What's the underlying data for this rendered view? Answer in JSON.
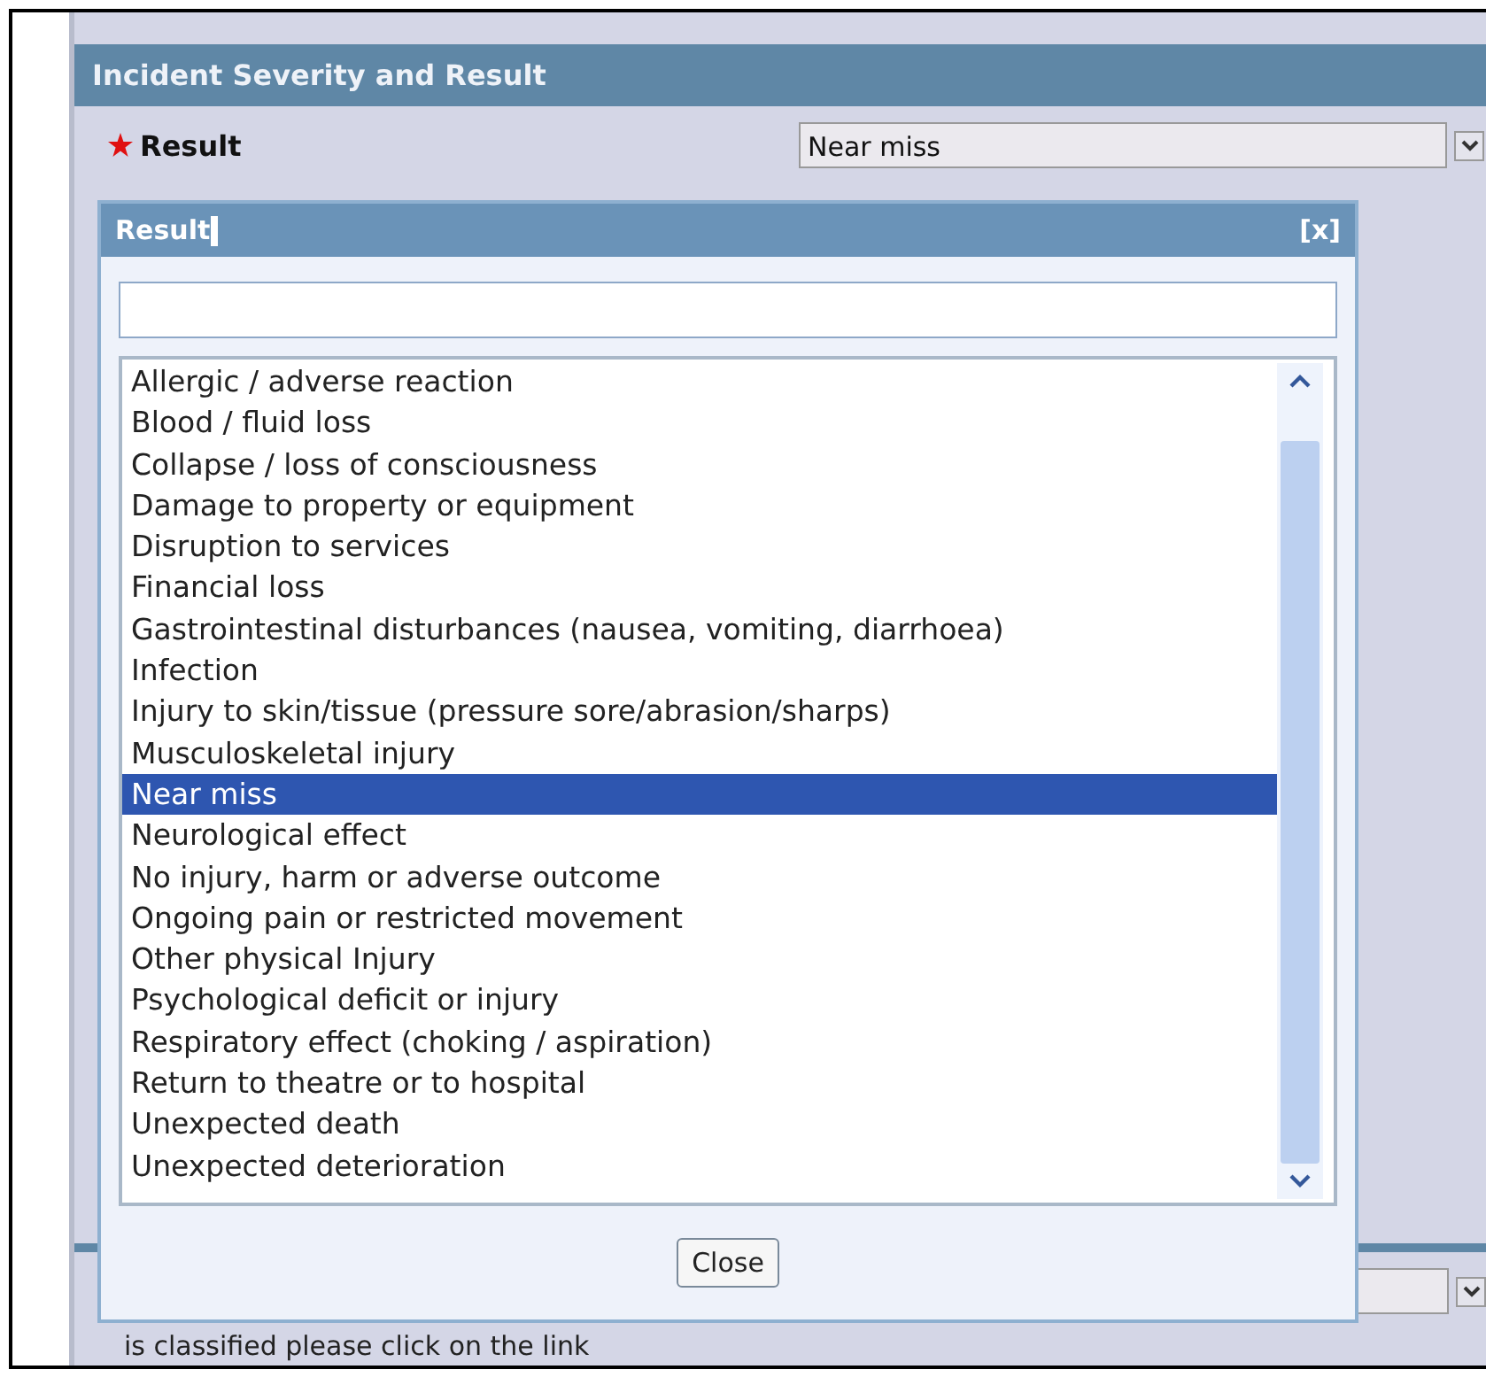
{
  "section": {
    "title": "Incident Severity and Result"
  },
  "result_field": {
    "label": "Result",
    "required": true,
    "value": "Near miss"
  },
  "dialog": {
    "title": "Result",
    "close": "[x]",
    "options": [
      {
        "label": "Allergic / adverse reaction",
        "selected": false
      },
      {
        "label": "Blood / fluid loss",
        "selected": false
      },
      {
        "label": "Collapse / loss of consciousness",
        "selected": false
      },
      {
        "label": "Damage to property or equipment",
        "selected": false
      },
      {
        "label": "Disruption to services",
        "selected": false
      },
      {
        "label": "Financial loss",
        "selected": false
      },
      {
        "label": "Gastrointestinal disturbances (nausea, vomiting, diarrhoea)",
        "selected": false
      },
      {
        "label": "Infection",
        "selected": false
      },
      {
        "label": "Injury to skin/tissue (pressure sore/abrasion/sharps)",
        "selected": false
      },
      {
        "label": "Musculoskeletal injury",
        "selected": false
      },
      {
        "label": "Near miss",
        "selected": true
      },
      {
        "label": "Neurological effect",
        "selected": false
      },
      {
        "label": "No injury, harm or adverse outcome",
        "selected": false
      },
      {
        "label": "Ongoing pain or restricted movement",
        "selected": false
      },
      {
        "label": "Other physical Injury",
        "selected": false
      },
      {
        "label": "Psychological deficit or injury",
        "selected": false
      },
      {
        "label": "Respiratory effect (choking / aspiration)",
        "selected": false
      },
      {
        "label": "Return to theatre or to hospital",
        "selected": false
      },
      {
        "label": "Unexpected death",
        "selected": false
      },
      {
        "label": "Unexpected deterioration",
        "selected": false
      }
    ],
    "button": "Close"
  },
  "footer_text": "is classified please click on the link"
}
